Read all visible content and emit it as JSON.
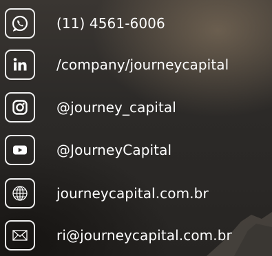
{
  "contacts": [
    {
      "id": "phone",
      "icon": "whatsapp-icon",
      "label": "(11) 4561-6006"
    },
    {
      "id": "linkedin",
      "icon": "linkedin-icon",
      "label": "/company/journeycapital"
    },
    {
      "id": "instagram",
      "icon": "instagram-icon",
      "label": "@journey_capital"
    },
    {
      "id": "youtube",
      "icon": "youtube-icon",
      "label": "@JourneyCapital"
    },
    {
      "id": "website",
      "icon": "globe-icon",
      "label": "journeycapital.com.br"
    },
    {
      "id": "email",
      "icon": "mail-icon",
      "label": "ri@journeycapital.com.br"
    }
  ],
  "colors": {
    "text": "#ffffff",
    "icon_border": "#f2f2f2",
    "background": "#2a2826"
  }
}
